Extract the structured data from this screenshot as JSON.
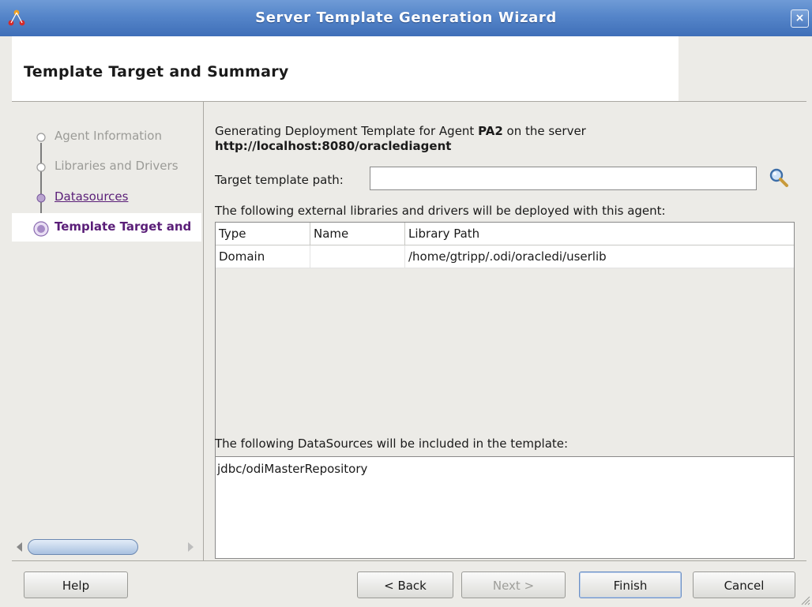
{
  "window": {
    "title": "Server Template Generation Wizard",
    "close_label": "×"
  },
  "header": {
    "page_title": "Template Target and Summary"
  },
  "nav": {
    "items": [
      {
        "label": "Agent Information",
        "state": "disabled"
      },
      {
        "label": "Libraries and Drivers",
        "state": "disabled"
      },
      {
        "label": "Datasources",
        "state": "link"
      },
      {
        "label": "Template Target and",
        "state": "current"
      }
    ]
  },
  "content": {
    "intro_prefix": "Generating Deployment Template for Agent ",
    "agent_name": "PA2",
    "intro_suffix": " on the server",
    "server_url": "http://localhost:8080/oraclediagent",
    "path_label": "Target template path:",
    "path_value": "",
    "libraries_caption": "The following external libraries and drivers will be deployed with this agent:",
    "libraries_table": {
      "columns": [
        "Type",
        "Name",
        "Library Path"
      ],
      "rows": [
        [
          "Domain",
          "",
          "/home/gtripp/.odi/oracledi/userlib"
        ]
      ]
    },
    "datasources_caption": "The following DataSources will be included in the template:",
    "datasources": [
      "jdbc/odiMasterRepository"
    ]
  },
  "footer": {
    "help": "Help",
    "back": "< Back",
    "next": "Next >",
    "finish": "Finish",
    "cancel": "Cancel"
  },
  "colors": {
    "titlebar": "#4f7fc4",
    "accent_purple": "#5a1e78"
  }
}
